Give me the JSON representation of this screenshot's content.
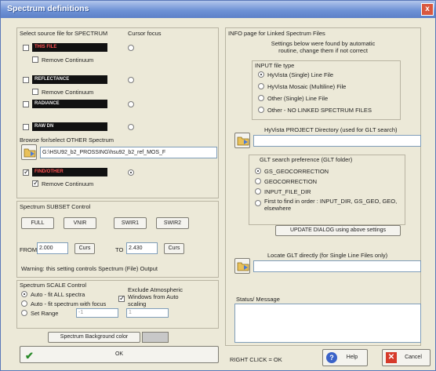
{
  "window": {
    "title": "Spectrum definitions",
    "close": "x"
  },
  "source": {
    "header": "Select source file for SPECTRUM",
    "cursor_focus": "Cursor focus",
    "this_file": "THIS FILE",
    "remove_continuum": "Remove Continuum",
    "reflectance": "REFLECTANCE",
    "radiance": "RADIANCE",
    "raw_dn": "RAW DN",
    "browse_label": "Browse for/select OTHER Spectrum",
    "path": "G:\\HSU92_b2_PROSSING\\hsu92_b2_ref_MOS_F",
    "find_other": "FIND/OTHER"
  },
  "subset": {
    "header": "Spectrum SUBSET Control",
    "buttons": [
      "FULL",
      "VNIR",
      "SWIR1",
      "SWIR2"
    ],
    "from_label": "FROM",
    "from_value": "2.000",
    "curs": "Curs",
    "to_label": "TO",
    "to_value": "2.430",
    "warning": "Warning: this setting controls Spectrum (File) Output"
  },
  "scale": {
    "header": "Spectrum SCALE Control",
    "options": [
      "Auto - fit ALL spectra",
      "Auto - fit spectrum with focus",
      "Set Range"
    ],
    "exclude": "Exclude Atmospheric Windows from Auto scaling",
    "range_min": "-1",
    "range_max": "1",
    "bg_button": "Spectrum Background color"
  },
  "ok": "OK",
  "info": {
    "header": "INFO page for Linked Spectrum Files",
    "note": "Settings below were found by automatic routine, change them if not correct",
    "input_header": "INPUT file type",
    "input_options": [
      "HyVista (Single) Line File",
      "HyVista Mosaic (Multiline) File",
      "Other (Single) Line File",
      "Other - NO LINKED SPECTRUM FILES"
    ],
    "project_label": "HyVista PROJECT Directory (used for GLT search)",
    "glt_header": "GLT search preference (GLT folder)",
    "glt_options": [
      "GS_GEOCORRECTION",
      "GEOCORRECTION",
      "INPUT_FILE_DIR",
      "First to find in order : INPUT_DIR, GS_GEO, GEO, elsewhere"
    ],
    "update_button": "UPDATE DIALOG using above settings",
    "locate_label": "Locate GLT directly (for Single Line Files only)",
    "status_label": "Status/ Message"
  },
  "footer": {
    "right_click": "RIGHT CLICK = OK",
    "help": "Help",
    "cancel": "Cancel"
  }
}
